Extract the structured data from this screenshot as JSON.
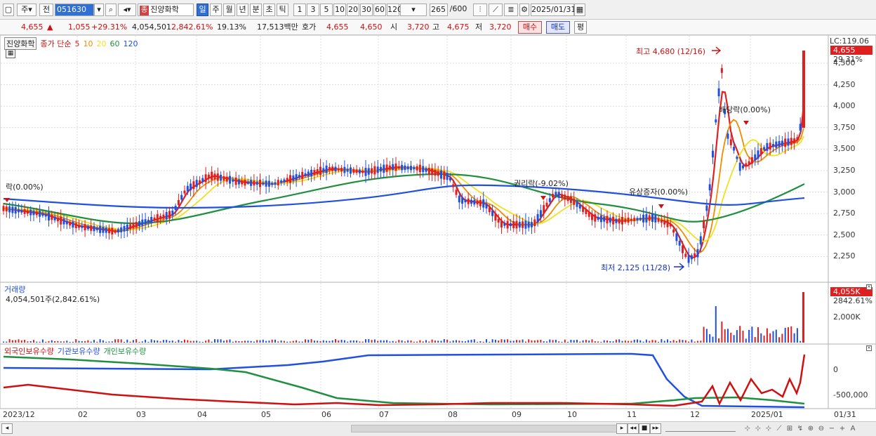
{
  "toolbar": {
    "type_label": "주",
    "prev_label": "전",
    "code": "051630",
    "name": "진양화학",
    "name_badge": "종",
    "periods": [
      "일",
      "주",
      "월",
      "년",
      "분",
      "초",
      "틱"
    ],
    "active_period": "일",
    "units": [
      "1",
      "3",
      "5",
      "10",
      "20",
      "30",
      "60",
      "120"
    ],
    "count": "265",
    "count_total": "/600",
    "date": "2025/01/31"
  },
  "infobar": {
    "price": "4,655",
    "arrow": "▲",
    "change": "1,055",
    "change_pct": "+29.31%",
    "volume": "4,054,501",
    "volume_pct": "2,842.61%",
    "turnover": "19.13%",
    "amount": "17,513백만",
    "quote_label": "호가",
    "ask": "4,655",
    "bid": "4,650",
    "open_label": "시",
    "open": "3,720",
    "high_label": "고",
    "high": "4,675",
    "low_label": "저",
    "low": "3,720",
    "buy": "매수",
    "sell": "매도",
    "eval": "평"
  },
  "price_panel": {
    "name": "진양화학",
    "ma_label": "종가 단순",
    "ma_periods": [
      "5",
      "10",
      "20",
      "60",
      "120"
    ],
    "ma_colors": [
      "#e02020",
      "#f08c00",
      "#f0e020",
      "#209040",
      "#2050e0"
    ],
    "high_note": "최고 4,680 (12/16)",
    "low_note": "최저 2,125 (11/28)",
    "events": [
      "권리락(-9.02%)",
      "유상증자(0.00%)",
      "배당락(0.00%)",
      "락(0.00%)"
    ],
    "lc": "LC:119.06",
    "last_price": "4,655",
    "last_pct": "29.31%",
    "y_ticks": [
      "4,500",
      "4,250",
      "4,000",
      "3,750",
      "3,500",
      "3,250",
      "3,000",
      "2,750",
      "2,500",
      "2,250"
    ]
  },
  "volume_panel": {
    "title": "거래량",
    "value": "4,054,501주(2,842.61%)",
    "last_value": "4,055K",
    "last_pct": "2842.61%",
    "y_ticks": [
      "2,000K"
    ]
  },
  "holder_panel": {
    "series": [
      "외국인보유수량",
      "기관보유수량",
      "개인보유수량"
    ],
    "colors": [
      "#d01010",
      "#2050e0",
      "#209040"
    ],
    "y_ticks": [
      "0",
      "-500,000"
    ]
  },
  "x_axis": {
    "labels": [
      "2023/12",
      "02",
      "03",
      "04",
      "05",
      "06",
      "07",
      "08",
      "09",
      "10",
      "11",
      "12",
      "2025/01"
    ],
    "end_label": "01/31"
  }
}
